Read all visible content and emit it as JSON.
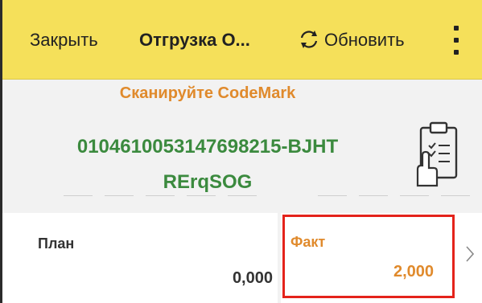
{
  "toolbar": {
    "close_label": "Закрыть",
    "title": "Отгрузка О...",
    "refresh_label": "Обновить",
    "refresh_icon": "refresh-icon",
    "more_icon": "more-vertical-icon"
  },
  "scan": {
    "prompt": "Сканируйте CodeMark",
    "code_line1": "010461005314769821­5-BJHT",
    "code_line2": "RErqSOG",
    "clipboard_icon": "clipboard-scan-icon"
  },
  "plan": {
    "label": "План",
    "value": "0,000"
  },
  "fact": {
    "label": "Факт",
    "value": "2,000",
    "chevron_icon": "chevron-right-icon"
  },
  "colors": {
    "toolbar_bg": "#f5e05a",
    "accent_orange": "#e08a2c",
    "code_green": "#3b8a3e",
    "highlight_red": "#e4231b"
  }
}
